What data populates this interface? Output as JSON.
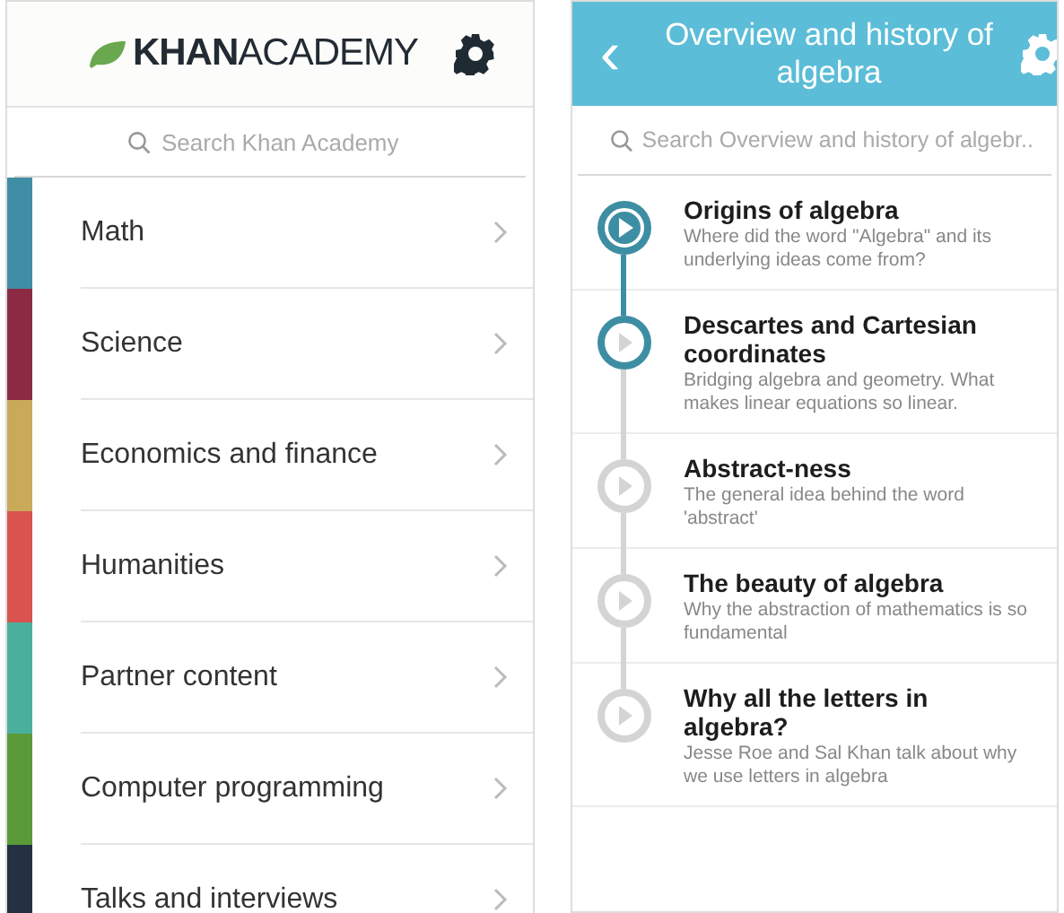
{
  "home": {
    "logo": "**KHAN**ACADEMY",
    "search": {
      "placeholder": "Search Khan Academy"
    },
    "subjects": [
      {
        "label": "Math",
        "color": "#3f8ea5"
      },
      {
        "label": "Science",
        "color": "#8c2a44"
      },
      {
        "label": "Economics and finance",
        "color": "#c9aa5a"
      },
      {
        "label": "Humanities",
        "color": "#d9534f"
      },
      {
        "label": "Partner content",
        "color": "#4bb09b"
      },
      {
        "label": "Computer programming",
        "color": "#5a9a39"
      },
      {
        "label": "Talks and interviews",
        "color": "#243140"
      }
    ]
  },
  "topic": {
    "title": "Overview and history of algebra",
    "back": "‹",
    "search": {
      "placeholder": "Search Overview and history of algebr.."
    },
    "videos": [
      {
        "title": "Origins of algebra",
        "description": "Where did the word \"Algebra\" and its underlying ideas come from?",
        "selected": true,
        "started": true
      },
      {
        "title": "Descartes and Cartesian coordinates",
        "description": "Bridging algebra and geometry.  What makes linear equations so linear.",
        "selected": false,
        "started": true
      },
      {
        "title": "Abstract-ness",
        "description": "The general idea behind the word 'abstract'",
        "selected": false,
        "started": false
      },
      {
        "title": "The beauty of algebra",
        "description": "Why the abstraction of mathematics is so fundamental",
        "selected": false,
        "started": false
      },
      {
        "title": "Why all the letters in algebra?",
        "description": "Jesse Roe and Sal Khan talk about why we use letters in algebra",
        "selected": false,
        "started": false
      }
    ]
  }
}
